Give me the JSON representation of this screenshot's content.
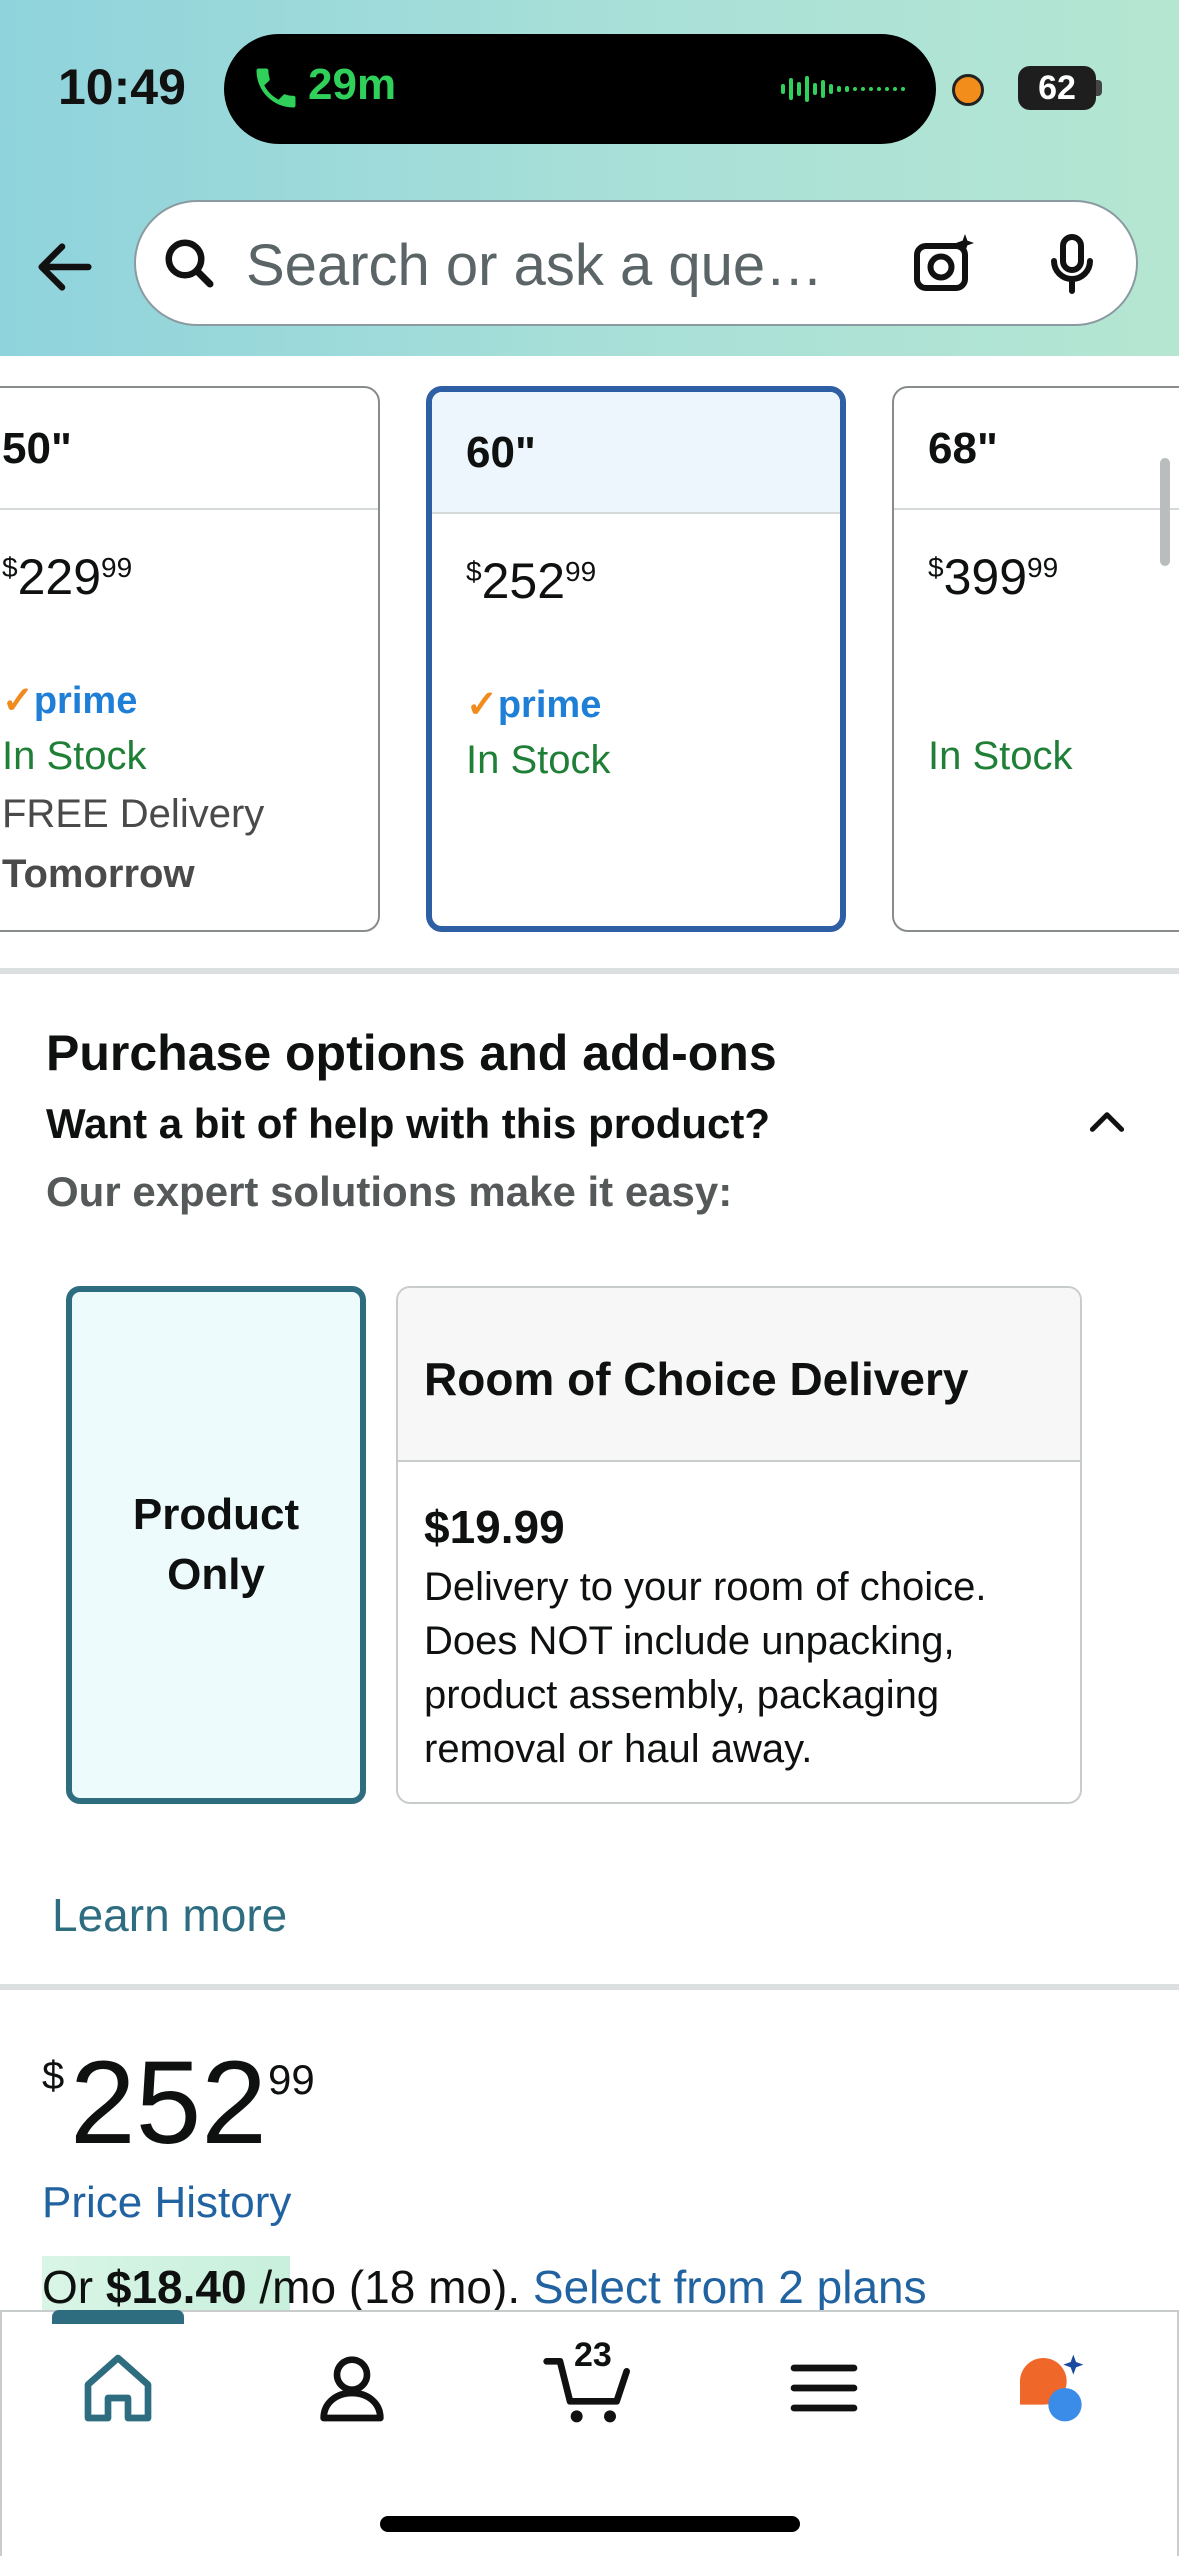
{
  "status_bar": {
    "time": "10:49",
    "call_duration": "29m",
    "battery": "62",
    "call_color": "#2fd15a"
  },
  "search": {
    "placeholder": "Search or ask a que…"
  },
  "size_options": [
    {
      "label": "50\"",
      "price_dollars": "229",
      "price_cents": "99",
      "prime": "prime",
      "stock": "In Stock",
      "delivery": "FREE Delivery",
      "delivery_day": "Tomorrow"
    },
    {
      "label": "60\"",
      "price_dollars": "252",
      "price_cents": "99",
      "prime": "prime",
      "stock": "In Stock",
      "selected": true
    },
    {
      "label": "68\"",
      "price_dollars": "399",
      "price_cents": "99",
      "stock": "In Stock"
    }
  ],
  "purchase_options": {
    "title": "Purchase options and add-ons",
    "help": "Want a bit of help with this product?",
    "expert": "Our expert solutions make it easy:",
    "product_only_line1": "Product",
    "product_only_line2": "Only",
    "room_title": "Room of Choice Delivery",
    "room_price": "$19.99",
    "room_description": "Delivery to your room of choice. Does NOT include unpacking, product assembly, packaging removal or haul away.",
    "learn_more": "Learn more"
  },
  "price": {
    "symbol": "$",
    "dollars": "252",
    "cents": "99",
    "history": "Price History",
    "financing_prefix": "Or ",
    "financing_amount": "$18.40",
    "financing_term": " /mo (18 mo). ",
    "financing_plans": "Select from 2 plans"
  },
  "bottom_nav": {
    "items": [
      "home-icon",
      "account-icon",
      "cart-icon",
      "menu-icon",
      "rufus-icon"
    ],
    "cart_count": "23",
    "active_color": "#2e6d80"
  }
}
